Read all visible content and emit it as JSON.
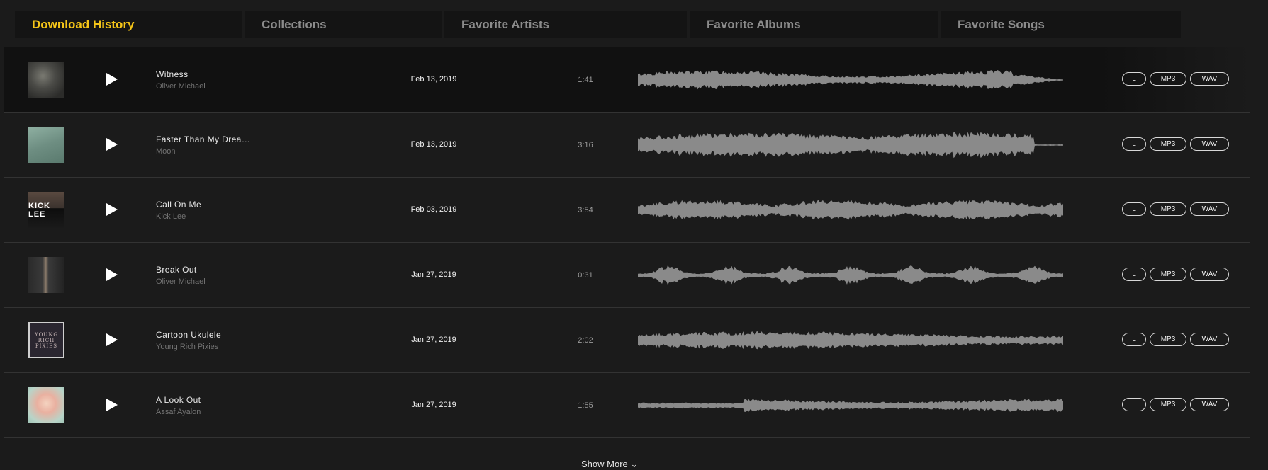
{
  "tabs": [
    {
      "label": "Download History",
      "active": true
    },
    {
      "label": "Collections",
      "active": false
    },
    {
      "label": "Favorite Artists",
      "active": false
    },
    {
      "label": "Favorite Albums",
      "active": false
    },
    {
      "label": "Favorite Songs",
      "active": false
    }
  ],
  "tracks": [
    {
      "title": "Witness",
      "artist": "Oliver Michael",
      "date": "Feb 13, 2019",
      "duration": "1:41",
      "cover_text": ""
    },
    {
      "title": "Faster Than My Drea…",
      "artist": "Moon",
      "date": "Feb 13, 2019",
      "duration": "3:16",
      "cover_text": ""
    },
    {
      "title": "Call On Me",
      "artist": "Kick Lee",
      "date": "Feb 03, 2019",
      "duration": "3:54",
      "cover_text": "KICK LEE"
    },
    {
      "title": "Break Out",
      "artist": "Oliver Michael",
      "date": "Jan 27, 2019",
      "duration": "0:31",
      "cover_text": ""
    },
    {
      "title": "Cartoon Ukulele",
      "artist": "Young Rich Pixies",
      "date": "Jan 27, 2019",
      "duration": "2:02",
      "cover_text": "YOUNG RICH PIXIES"
    },
    {
      "title": "A Look Out",
      "artist": "Assaf Ayalon",
      "date": "Jan 27, 2019",
      "duration": "1:55",
      "cover_text": ""
    }
  ],
  "download_buttons": {
    "license": "L",
    "mp3": "MP3",
    "wav": "WAV"
  },
  "show_more": "Show More ⌄",
  "colors": {
    "accent": "#f5c518",
    "background": "#1b1b1b",
    "tab_background": "#141414",
    "waveform": "#8a8a8a"
  },
  "icons": {
    "play": "play-icon",
    "show_more": "chevron-down-icon"
  }
}
